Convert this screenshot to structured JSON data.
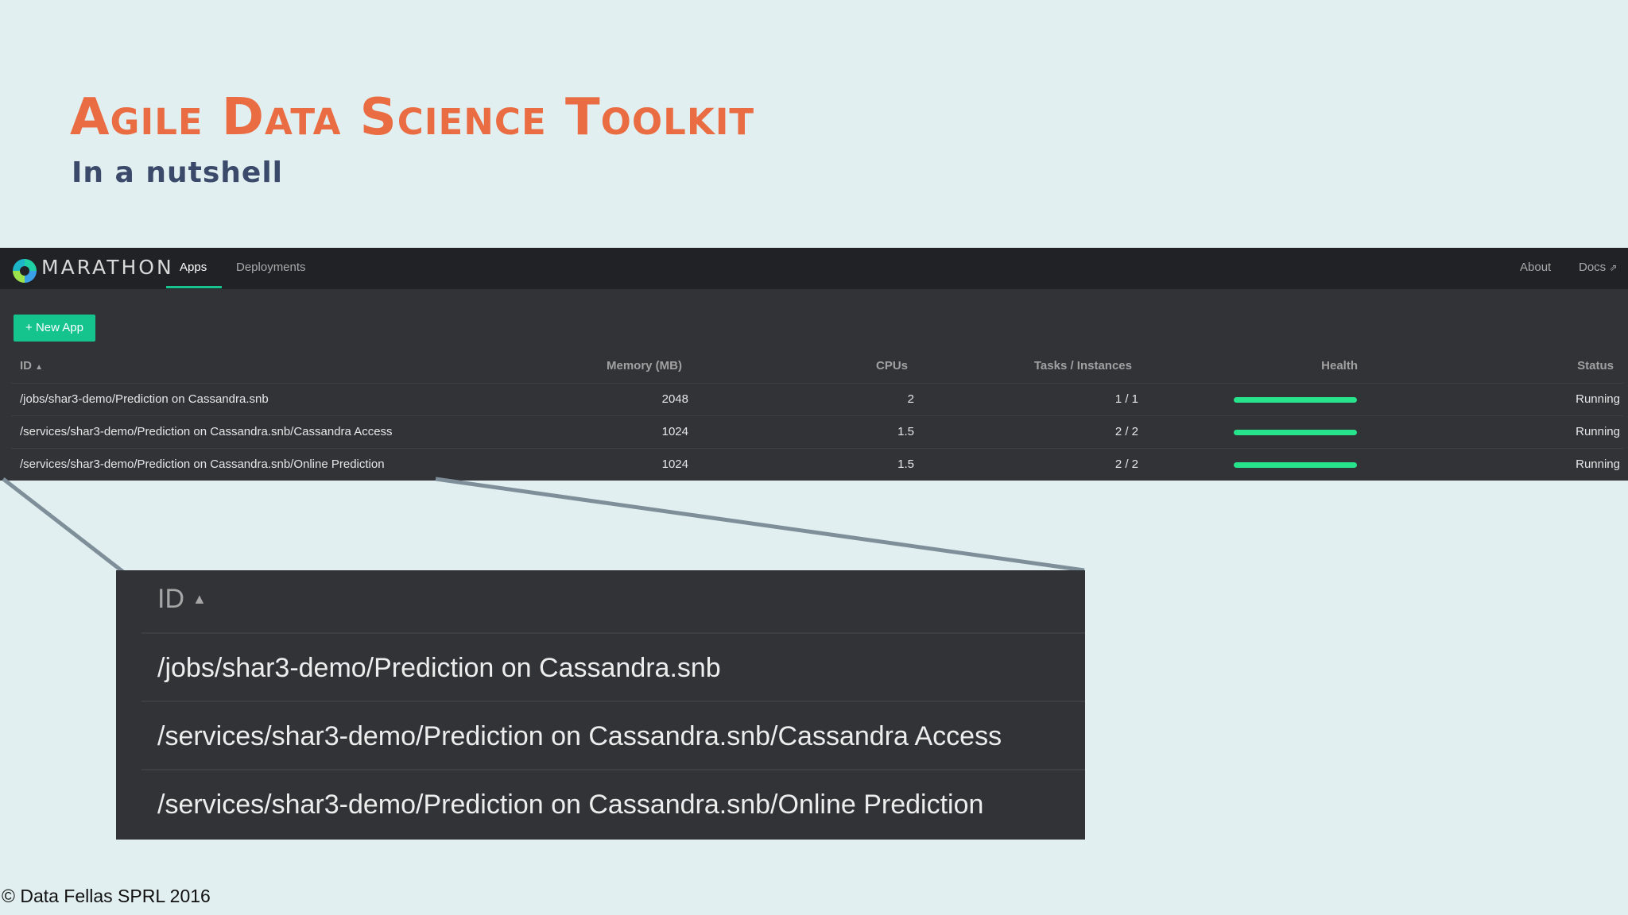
{
  "slide": {
    "title": "Agile Data Science Toolkit",
    "subtitle": "In a nutshell",
    "footer": "© Data Fellas SPRL 2016",
    "accent_color": "#ea6c43",
    "subtitle_color": "#3b4a6b"
  },
  "marathon": {
    "brand": "MARATHON",
    "logo_icon": "marathon-logo-icon",
    "tabs": [
      {
        "label": "Apps",
        "active": true
      },
      {
        "label": "Deployments",
        "active": false
      }
    ],
    "nav_right": [
      {
        "label": "About"
      },
      {
        "label": "Docs",
        "icon": "external-link-icon"
      }
    ],
    "new_app_button": "+ New App",
    "health_color": "#27e38b",
    "columns": {
      "id": "ID",
      "memory": "Memory (MB)",
      "cpus": "CPUs",
      "tasks": "Tasks / Instances",
      "health": "Health",
      "status": "Status"
    },
    "rows": [
      {
        "id": "/jobs/shar3-demo/Prediction on Cassandra.snb",
        "memory": "2048",
        "cpus": "2",
        "tasks": "1 / 1",
        "health": 1.0,
        "status": "Running"
      },
      {
        "id": "/services/shar3-demo/Prediction on Cassandra.snb/Cassandra Access",
        "memory": "1024",
        "cpus": "1.5",
        "tasks": "2 / 2",
        "health": 1.0,
        "status": "Running"
      },
      {
        "id": "/services/shar3-demo/Prediction on Cassandra.snb/Online Prediction",
        "memory": "1024",
        "cpus": "1.5",
        "tasks": "2 / 2",
        "health": 1.0,
        "status": "Running"
      }
    ]
  },
  "zoom": {
    "header": "ID",
    "rows": [
      "/jobs/shar3-demo/Prediction on Cassandra.snb",
      "/services/shar3-demo/Prediction on Cassandra.snb/Cassandra Access",
      "/services/shar3-demo/Prediction on Cassandra.snb/Online Prediction"
    ]
  }
}
